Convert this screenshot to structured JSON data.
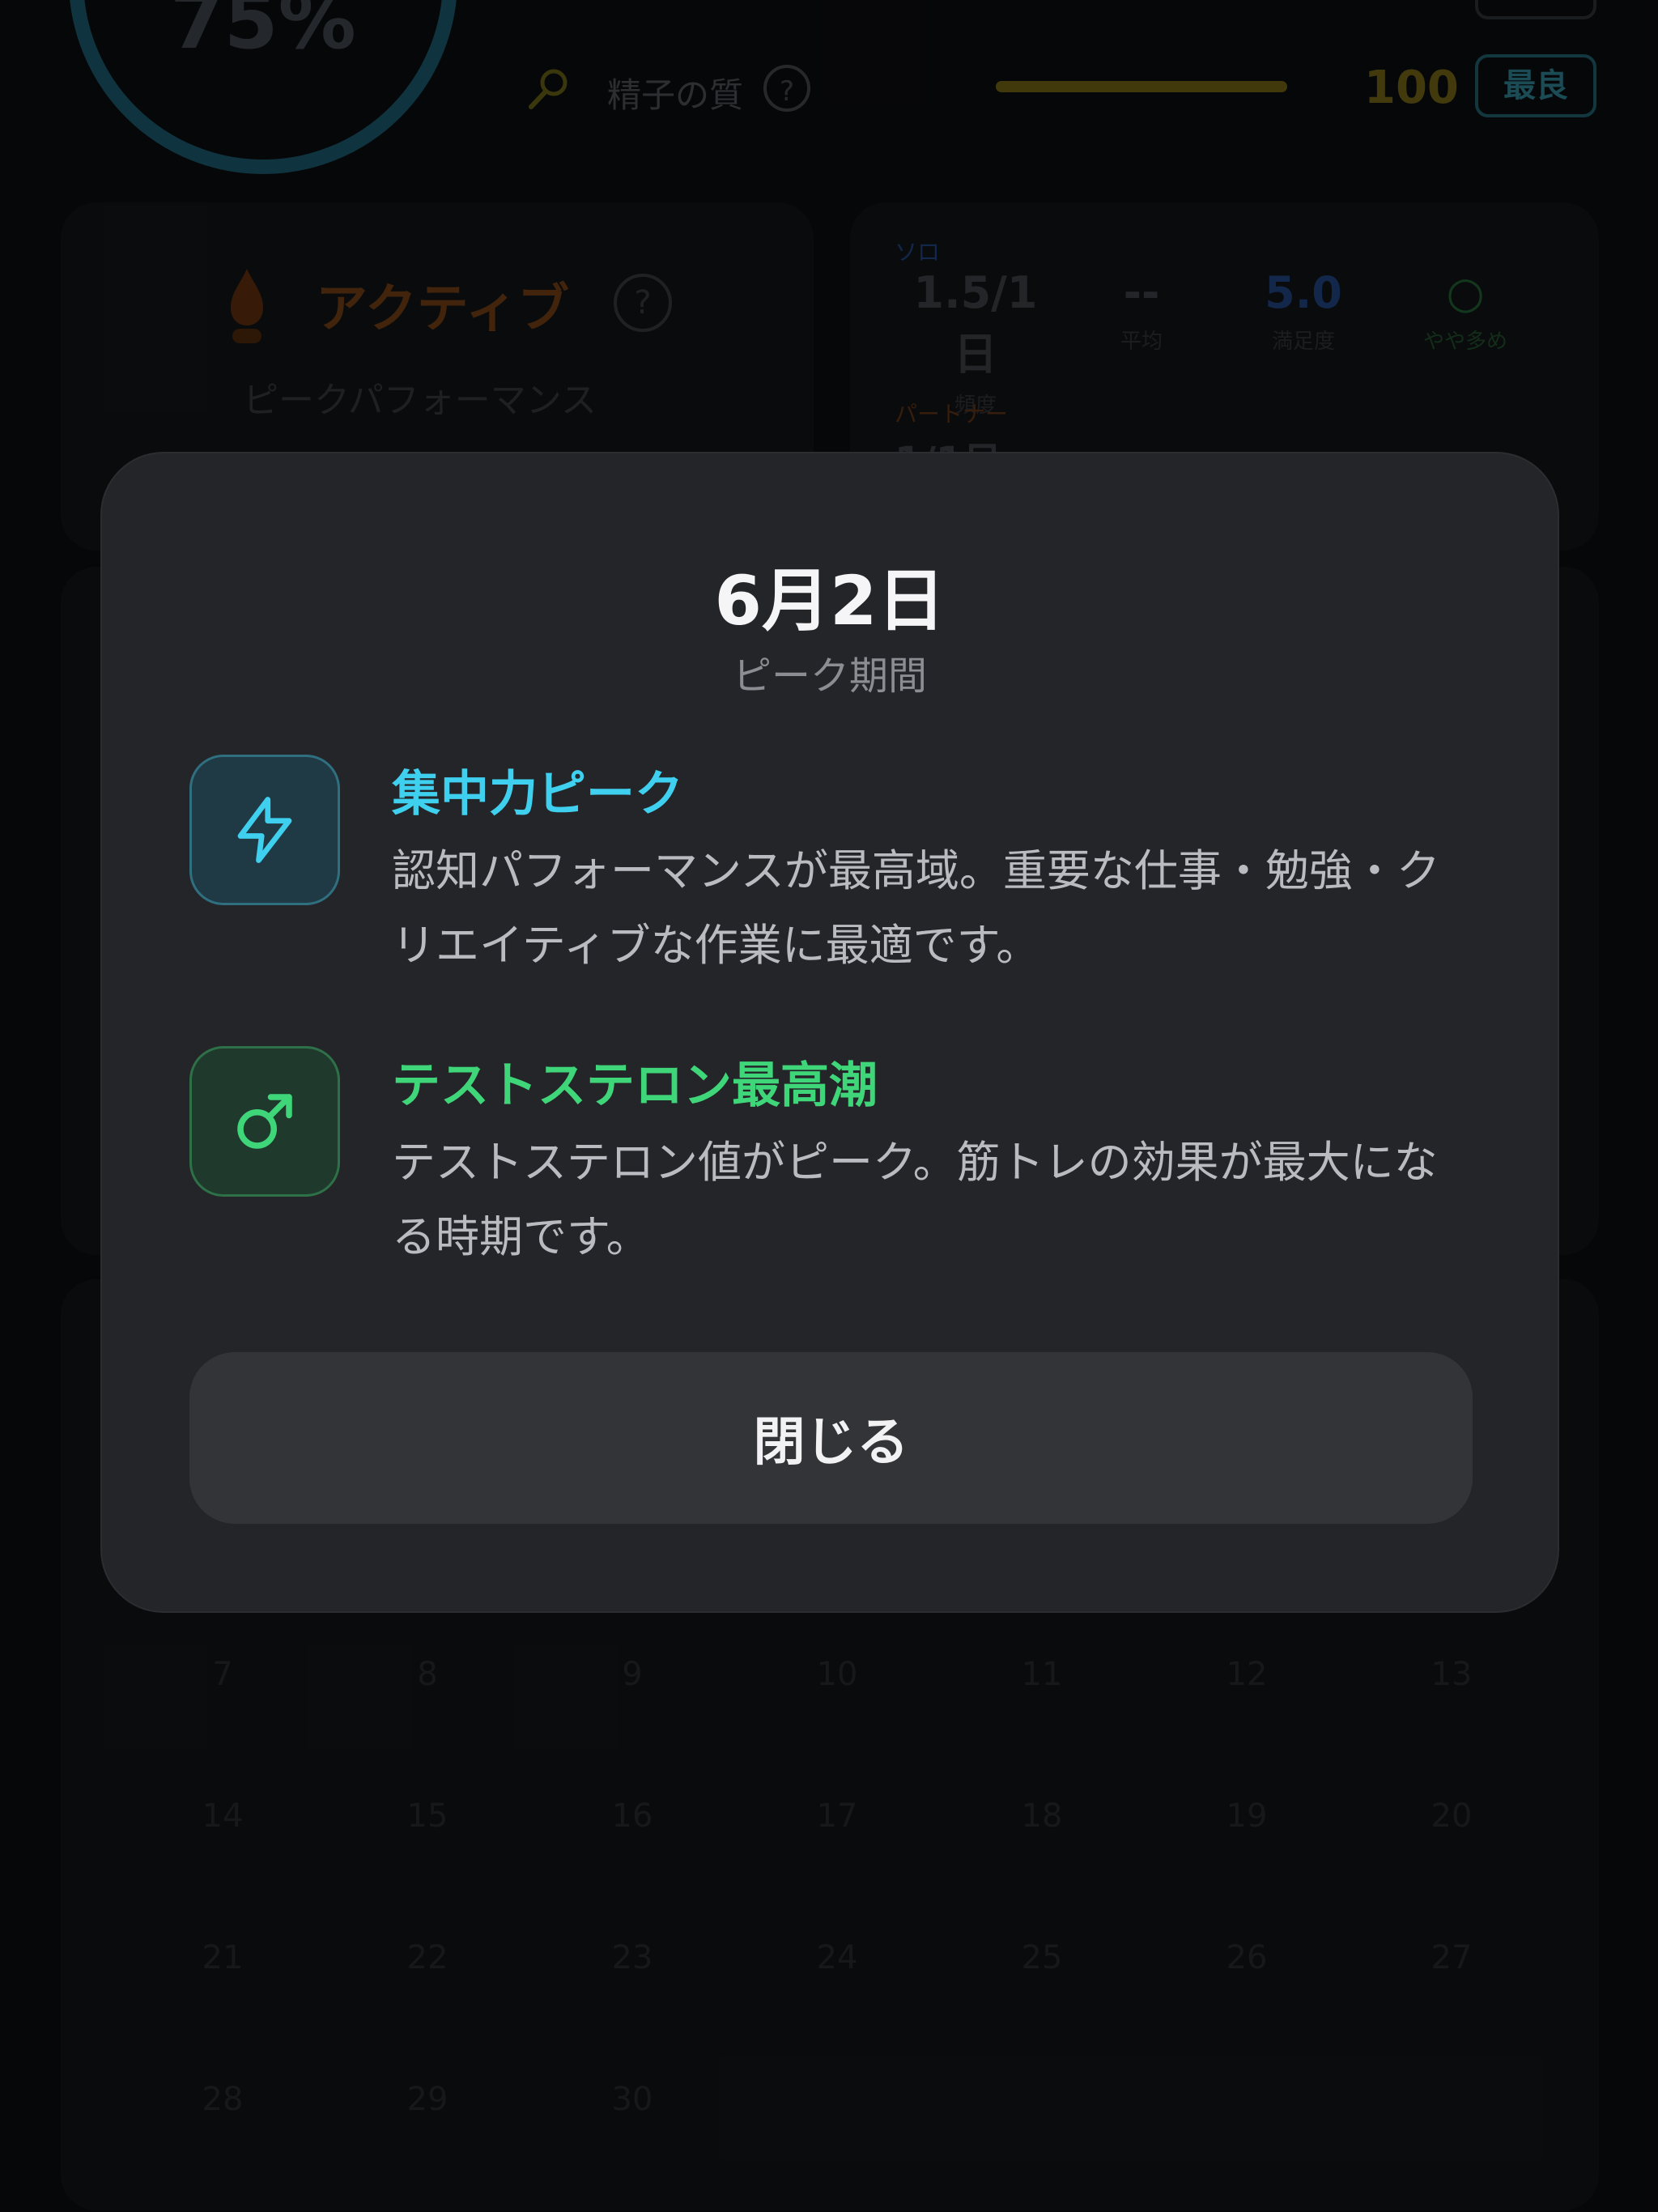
{
  "background": {
    "score_ring": {
      "value_text": "75%"
    },
    "sperm_quality": {
      "label": "精子の質",
      "help": "?",
      "value": "100",
      "badge": "最良",
      "level": 1.0
    },
    "status_card": {
      "title": "アクティブ",
      "help": "?",
      "subtitle": "ピークパフォーマンス"
    },
    "stats_card": {
      "solo_label": "ソロ",
      "solo": [
        {
          "value": "1.5/1日",
          "caption": "頻度",
          "color": "#3a3d42"
        },
        {
          "value": "--",
          "caption": "平均",
          "color": "#3a3d42"
        },
        {
          "value": "5.0",
          "caption": "満足度",
          "color": "#1f3f7a"
        },
        {
          "value": "○",
          "caption": "やや多め",
          "color": "#1f5a2f"
        }
      ],
      "partner_label": "パートナー",
      "partner_value": "1/1日"
    },
    "calendar_numbers": [
      [
        "7",
        "8",
        "9",
        "10",
        "11",
        "12",
        "13"
      ],
      [
        "14",
        "15",
        "16",
        "17",
        "18",
        "19",
        "20"
      ],
      [
        "21",
        "22",
        "23",
        "24",
        "25",
        "26",
        "27"
      ],
      [
        "28",
        "29",
        "30",
        "",
        "",
        "",
        ""
      ]
    ]
  },
  "modal": {
    "title": "6月2日",
    "subtitle": "ピーク期間",
    "items": [
      {
        "icon": "lightning-icon",
        "title": "集中力ピーク",
        "description": "認知パフォーマンスが最高域。重要な仕事・勉強・クリエイティブな作業に最適です。",
        "color": "#3ed0ee"
      },
      {
        "icon": "male-symbol-icon",
        "title": "テストステロン最高潮",
        "description": "テストステロン値がピーク。筋トレの効果が最大になる時期です。",
        "color": "#3fd67a"
      }
    ],
    "close_label": "閉じる"
  }
}
